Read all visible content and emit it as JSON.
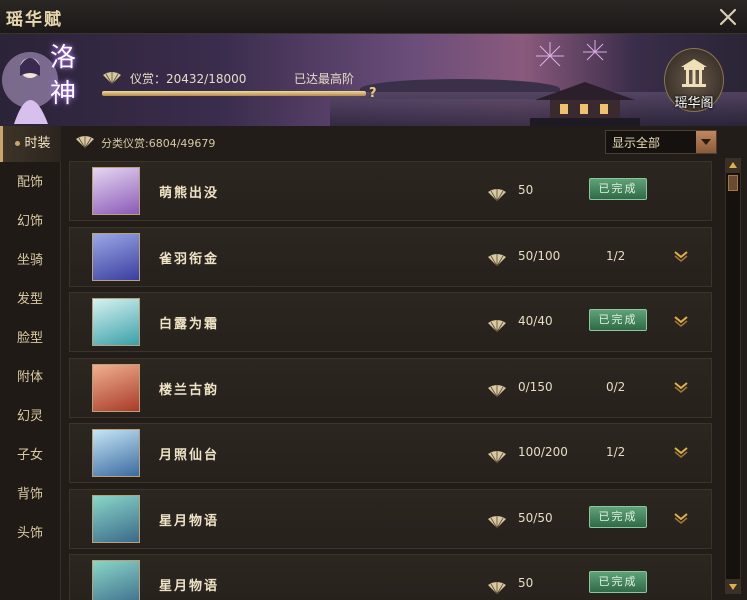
{
  "window": {
    "title": "瑶华赋"
  },
  "banner": {
    "logo_text": "洛神",
    "reward_label": "仪赏：20432/18000",
    "reward_progress": 1.0,
    "max_text": "已达最高阶",
    "help_label": "?",
    "pavilion_label": "瑶华阁"
  },
  "sidebar": {
    "items": [
      {
        "label": "时装"
      },
      {
        "label": "配饰"
      },
      {
        "label": "幻饰"
      },
      {
        "label": "坐骑"
      },
      {
        "label": "发型"
      },
      {
        "label": "脸型"
      },
      {
        "label": "附体"
      },
      {
        "label": "幻灵"
      },
      {
        "label": "子女"
      },
      {
        "label": "背饰"
      },
      {
        "label": "头饰"
      }
    ]
  },
  "main": {
    "category_reward": "分类仪赏:6804/49679",
    "filter": {
      "selected": "显示全部"
    },
    "completed_label": "已完成",
    "rows": [
      {
        "name": "萌熊出没",
        "value": "50",
        "frac": "",
        "completed": true,
        "expandable": false,
        "thumb_colors": [
          "#e6d6f2",
          "#8a5ab8"
        ]
      },
      {
        "name": "雀羽衔金",
        "value": "50/100",
        "frac": "1/2",
        "completed": false,
        "expandable": true,
        "thumb_colors": [
          "#9aa8e6",
          "#3a3ea0"
        ]
      },
      {
        "name": "白露为霜",
        "value": "40/40",
        "frac": "",
        "completed": true,
        "expandable": true,
        "thumb_colors": [
          "#d6f2f2",
          "#3aa0a8"
        ]
      },
      {
        "name": "楼兰古韵",
        "value": "0/150",
        "frac": "0/2",
        "completed": false,
        "expandable": true,
        "thumb_colors": [
          "#f0b090",
          "#a83a2a"
        ]
      },
      {
        "name": "月照仙台",
        "value": "100/200",
        "frac": "1/2",
        "completed": false,
        "expandable": true,
        "thumb_colors": [
          "#c6e6f6",
          "#3a6aa0"
        ]
      },
      {
        "name": "星月物语",
        "value": "50/50",
        "frac": "",
        "completed": true,
        "expandable": true,
        "thumb_colors": [
          "#8ad6c8",
          "#3a6a8a"
        ]
      },
      {
        "name": "星月物语",
        "value": "50",
        "frac": "",
        "completed": true,
        "expandable": false,
        "thumb_colors": [
          "#8ad6c8",
          "#3a6a8a"
        ]
      }
    ]
  },
  "colors": {
    "accent_gold": "#c9a76a",
    "completed_green": "#3f8a5a",
    "banner_purple": "#6a4d7a"
  }
}
